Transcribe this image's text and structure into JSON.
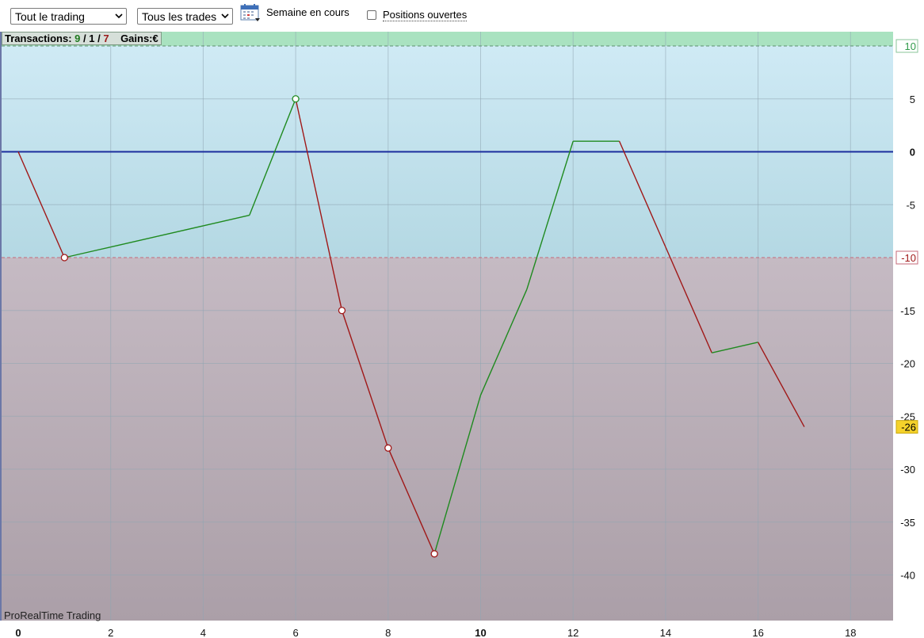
{
  "toolbar": {
    "scope_select": "Tout le trading",
    "trades_select": "Tous les trades",
    "period_label": "Semaine en cours",
    "open_positions_label": "Positions ouvertes",
    "open_positions_checked": false,
    "calendar_icon": "calendar-icon"
  },
  "summary": {
    "transactions_label": "Transactions:",
    "winning": "9",
    "separator": "/",
    "neutral": "1",
    "losing": "7",
    "gains_label": "Gains:",
    "currency": "€"
  },
  "brand": "ProRealTime Trading",
  "colors": {
    "profit_zone": "#c7e6f2",
    "loss_zone": "#baa8b3",
    "target_band": "#a9e2c0",
    "up_line": "#1f8a1f",
    "down_line": "#a01818",
    "zero_line": "#1b2d9e",
    "last_value_badge": "#f5d22b"
  },
  "chart_data": {
    "type": "line",
    "title": "",
    "xlabel": "",
    "ylabel": "",
    "x": [
      0,
      1,
      2,
      3,
      4,
      5,
      6,
      7,
      8,
      9,
      10,
      11,
      12,
      13,
      14,
      15,
      16,
      17
    ],
    "y": [
      0,
      -10,
      -9,
      -8,
      -7,
      -6,
      5,
      -15,
      -28,
      -38,
      -23,
      -13,
      1,
      1,
      -9,
      -19,
      -18,
      -26
    ],
    "markers": [
      {
        "x": 1,
        "y": -10,
        "kind": "loss"
      },
      {
        "x": 6,
        "y": 5,
        "kind": "gain"
      },
      {
        "x": 7,
        "y": -15,
        "kind": "loss"
      },
      {
        "x": 8,
        "y": -28,
        "kind": "loss"
      },
      {
        "x": 9,
        "y": -38,
        "kind": "loss"
      }
    ],
    "xlim": [
      0,
      19
    ],
    "ylim": [
      -44,
      10.5
    ],
    "x_ticks": [
      "0",
      "2",
      "4",
      "6",
      "8",
      "10",
      "12",
      "14",
      "16",
      "18"
    ],
    "y_ticks": [
      "5",
      "0",
      "-5",
      "-10",
      "-15",
      "-20",
      "-25",
      "-30",
      "-35",
      "-40"
    ],
    "upper_level": {
      "value": 10,
      "label": "10"
    },
    "lower_level": {
      "value": -10,
      "label": "-10"
    },
    "last_value": {
      "value": -26,
      "label": "-26"
    },
    "grid": true
  }
}
